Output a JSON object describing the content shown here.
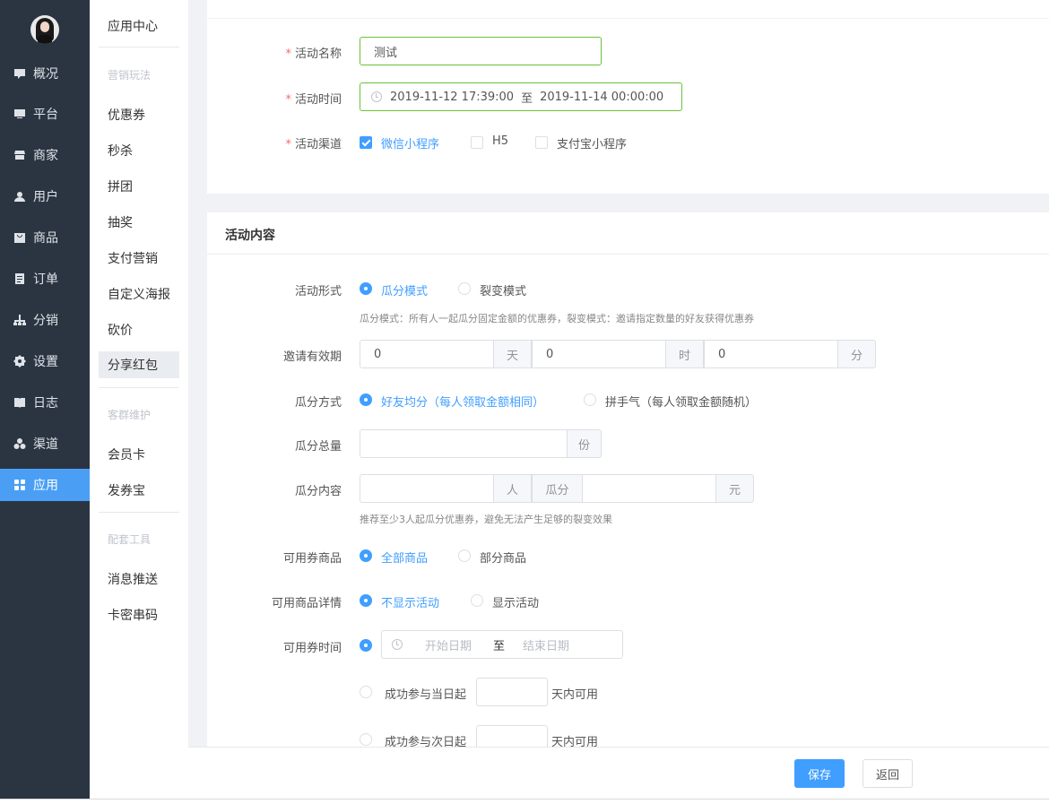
{
  "nav": [
    {
      "label": "概况",
      "icon": "overview-icon"
    },
    {
      "label": "平台",
      "icon": "platform-icon"
    },
    {
      "label": "商家",
      "icon": "store-icon"
    },
    {
      "label": "用户",
      "icon": "user-icon"
    },
    {
      "label": "商品",
      "icon": "product-icon"
    },
    {
      "label": "订单",
      "icon": "order-icon"
    },
    {
      "label": "分销",
      "icon": "distribution-icon"
    },
    {
      "label": "设置",
      "icon": "settings-icon"
    },
    {
      "label": "日志",
      "icon": "log-icon"
    },
    {
      "label": "渠道",
      "icon": "channel-icon"
    },
    {
      "label": "应用",
      "icon": "apps-icon"
    }
  ],
  "subnav": {
    "title": "应用中心",
    "group1": "营销玩法",
    "items1": [
      "优惠券",
      "秒杀",
      "拼团",
      "抽奖",
      "支付营销",
      "自定义海报",
      "砍价",
      "分享红包"
    ],
    "group2": "客群维护",
    "items2": [
      "会员卡",
      "发券宝"
    ],
    "group3": "配套工具",
    "items3": [
      "消息推送",
      "卡密串码"
    ]
  },
  "basic": {
    "name_label": "活动名称",
    "name_value": "测试",
    "time_label": "活动时间",
    "time_start": "2019-11-12 17:39:00",
    "time_sep": "至",
    "time_end": "2019-11-14 00:00:00",
    "channel_label": "活动渠道",
    "channels": [
      "微信小程序",
      "H5",
      "支付宝小程序"
    ]
  },
  "content": {
    "heading": "活动内容",
    "form_label": "活动形式",
    "form_opts": [
      "瓜分模式",
      "裂变模式"
    ],
    "form_hint": "瓜分模式：所有人一起瓜分固定金额的优惠券，裂变模式：邀请指定数量的好友获得优惠券",
    "valid_label": "邀请有效期",
    "valid_day": "0",
    "unit_day": "天",
    "valid_hour": "0",
    "unit_hour": "时",
    "valid_min": "0",
    "unit_min": "分",
    "split_label": "瓜分方式",
    "split_opts": [
      "好友均分（每人领取金额相同）",
      "拼手气（每人领取金额随机）"
    ],
    "total_label": "瓜分总量",
    "total_unit": "份",
    "split_content_label": "瓜分内容",
    "unit_person": "人",
    "unit_split": "瓜分",
    "unit_yuan": "元",
    "content_hint": "推荐至少3人起瓜分优惠券，避免无法产生足够的裂变效果",
    "goods_label": "可用券商品",
    "goods_opts": [
      "全部商品",
      "部分商品"
    ],
    "detail_label": "可用商品详情",
    "detail_opts": [
      "不显示活动",
      "显示活动"
    ],
    "coupon_time_label": "可用券时间",
    "start_placeholder": "开始日期",
    "date_sep": "至",
    "end_placeholder": "结束日期",
    "same_day": "成功参与当日起",
    "next_day": "成功参与次日起",
    "days_usable": "天内可用"
  },
  "footer": {
    "save": "保存",
    "back": "返回"
  },
  "colors": {
    "accent": "#409eff",
    "sidebar": "#2b3542",
    "nav_active": "#4a9ff5",
    "valid_border": "#67c23a"
  }
}
